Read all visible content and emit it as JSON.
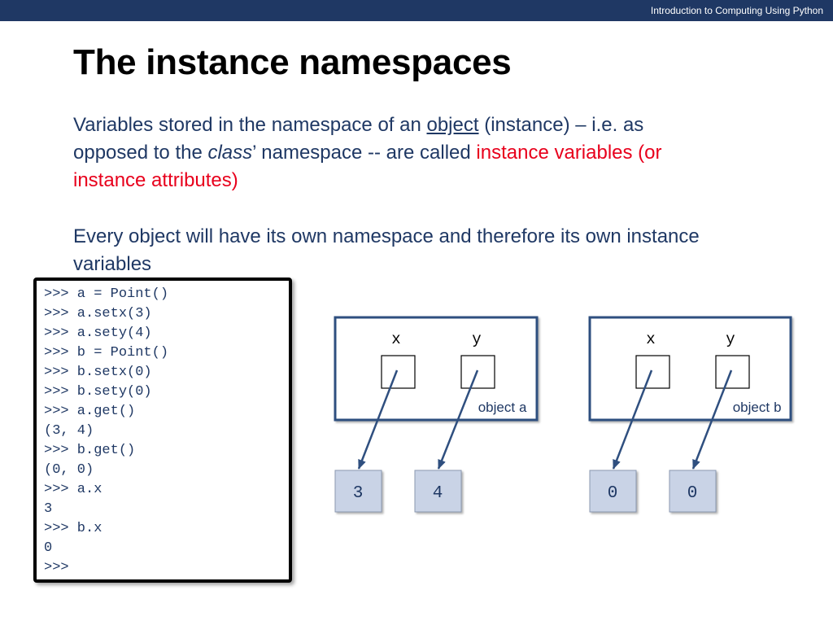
{
  "header": {
    "course": "Introduction to Computing Using Python"
  },
  "slide": {
    "title": "The instance namespaces",
    "para1": {
      "part1": "Variables stored in the namespace of an ",
      "object_word": "object",
      "part2": " (instance) – i.e. as opposed to the ",
      "class_word": "class",
      "part3": "’ namespace -- are called ",
      "highlight": "instance variables (or instance attributes)"
    },
    "para2": "Every object will have its own namespace and therefore its own instance variables"
  },
  "console": {
    "lines": [
      ">>> a = Point()",
      ">>> a.setx(3)",
      ">>> a.sety(4)",
      ">>> b = Point()",
      ">>> b.setx(0)",
      ">>> b.sety(0)",
      ">>> a.get()",
      "(3, 4)",
      ">>> b.get()",
      "(0, 0)",
      ">>> a.x",
      "3",
      ">>> b.x",
      "0",
      ">>>"
    ]
  },
  "diagram": {
    "objects": [
      {
        "label_prefix": "object ",
        "label_var": "a",
        "attr_x": "x",
        "attr_y": "y",
        "value_x": "3",
        "value_y": "4"
      },
      {
        "label_prefix": "object ",
        "label_var": "b",
        "attr_x": "x",
        "attr_y": "y",
        "value_x": "0",
        "value_y": "0"
      }
    ]
  },
  "colors": {
    "topbar": "#1f3864",
    "text": "#1f3864",
    "highlight": "#e8001c",
    "value_box": "#c9d3e6"
  }
}
